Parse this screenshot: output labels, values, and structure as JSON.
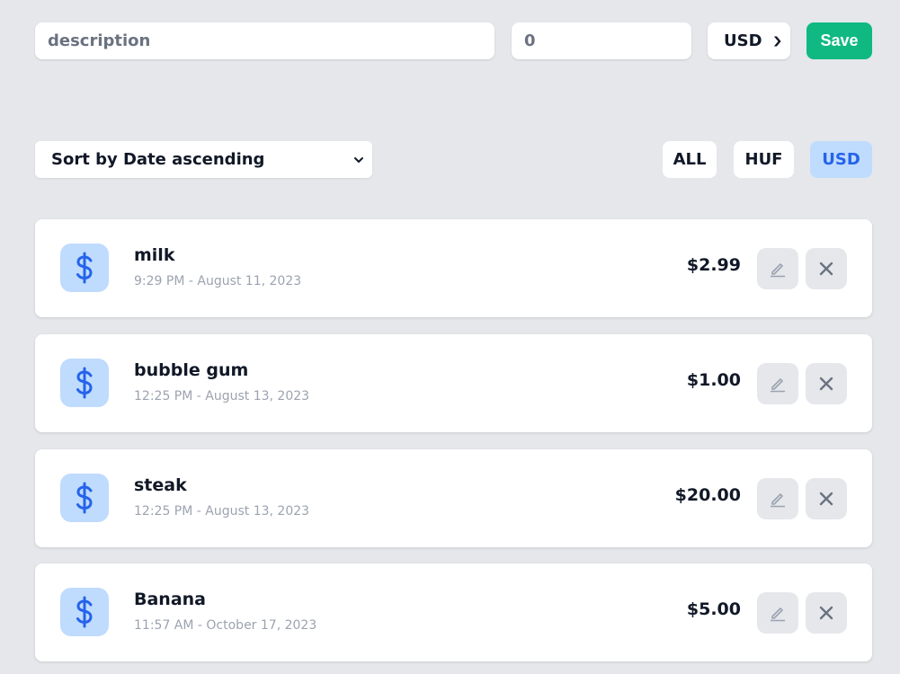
{
  "form": {
    "description_placeholder": "description",
    "amount_value": "0",
    "currency_value": "USD",
    "save_label": "Save"
  },
  "sort": {
    "selected": "Sort by Date ascending"
  },
  "filters": {
    "all": "ALL",
    "huf": "HUF",
    "usd": "USD",
    "active": "USD"
  },
  "colors": {
    "background": "#e5e7eb",
    "save": "#10b981",
    "accent": "#2563eb",
    "accent_light": "#bfdbfe"
  },
  "expenses": [
    {
      "icon": "dollar-icon",
      "title": "milk",
      "date": "9:29 PM - August 11, 2023",
      "amount": "$2.99"
    },
    {
      "icon": "dollar-icon",
      "title": "bubble gum",
      "date": "12:25 PM - August 13, 2023",
      "amount": "$1.00"
    },
    {
      "icon": "dollar-icon",
      "title": "steak",
      "date": "12:25 PM - August 13, 2023",
      "amount": "$20.00"
    },
    {
      "icon": "dollar-icon",
      "title": "Banana",
      "date": "11:57 AM - October 17, 2023",
      "amount": "$5.00"
    }
  ]
}
